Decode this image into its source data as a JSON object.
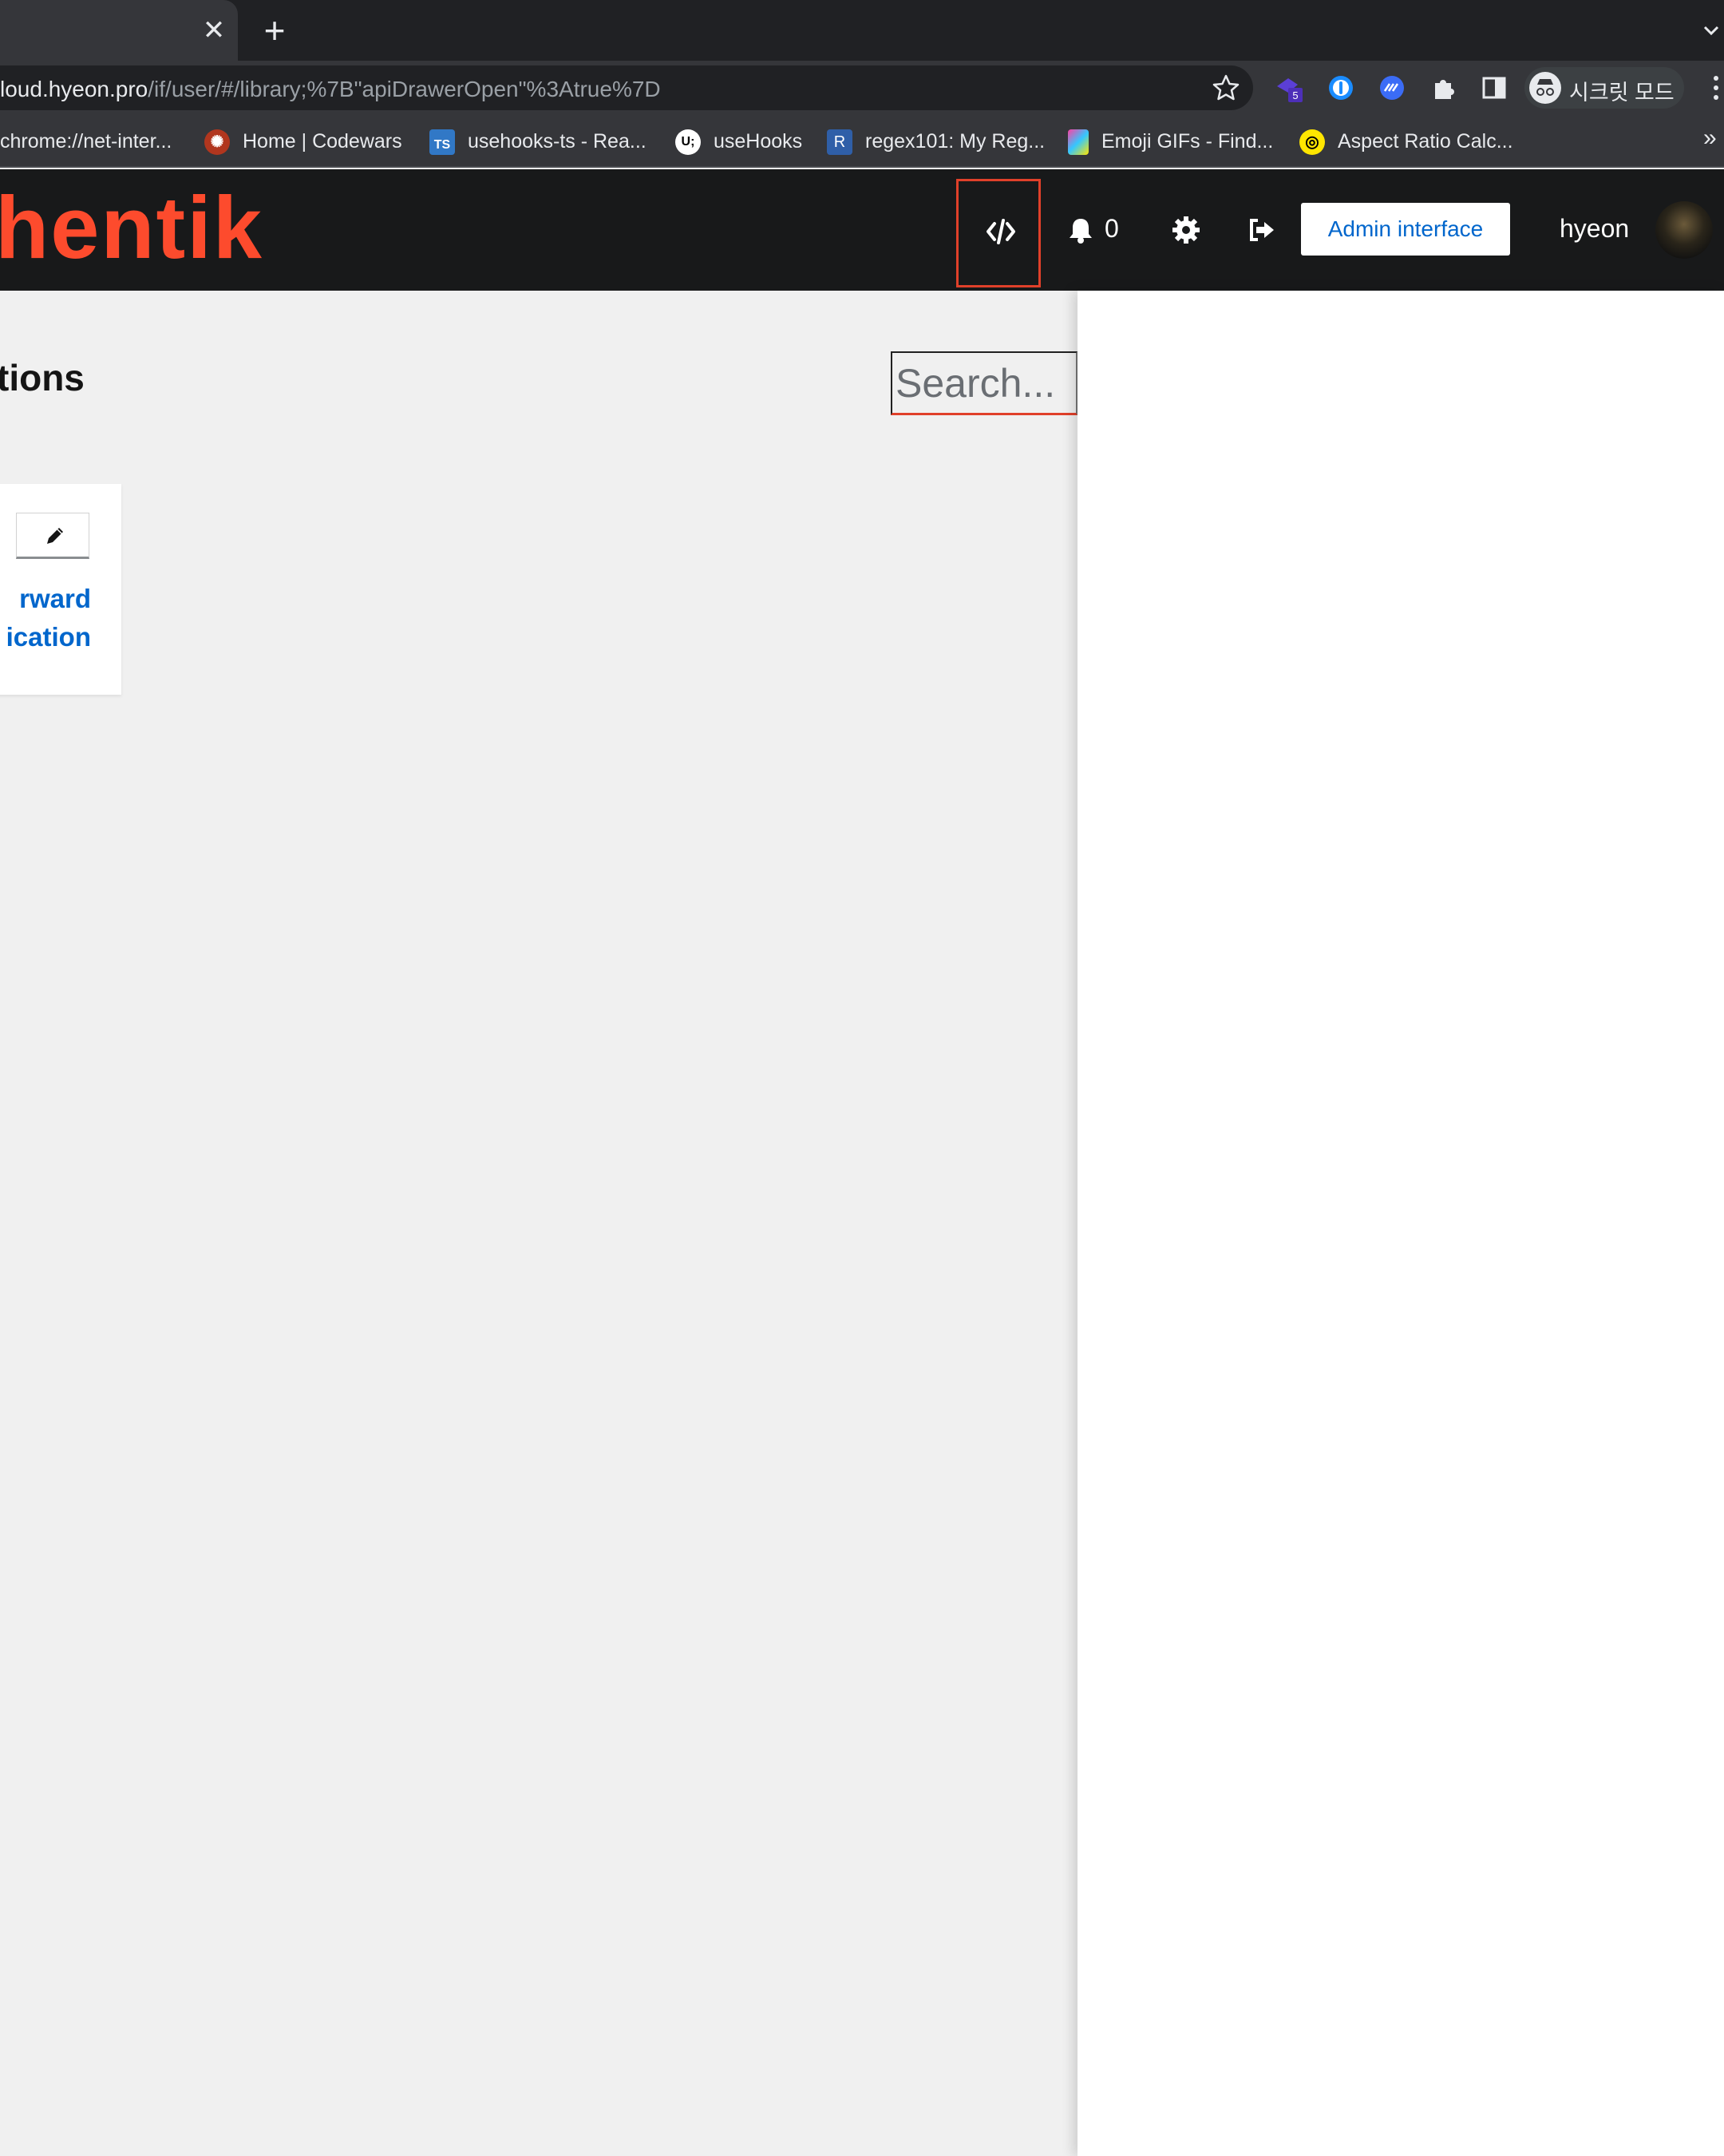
{
  "browser": {
    "tab_close": "✕",
    "new_tab": "+",
    "url_host": "loud.hyeon.pro",
    "url_path": "/if/user/#/library;%7B\"apiDrawerOpen\"%3Atrue%7D",
    "extension_badge": "5",
    "incognito_label": "시크릿 모드",
    "bookmarks": [
      {
        "label": "chrome://net-inter...",
        "icon": "chrome-icon"
      },
      {
        "label": "Home | Codewars",
        "icon": "codewars-icon"
      },
      {
        "label": "usehooks-ts - Rea...",
        "icon": "typescript-icon",
        "glyph": "TS"
      },
      {
        "label": "useHooks",
        "icon": "usehooks-icon",
        "glyph": "U;"
      },
      {
        "label": "regex101: My Reg...",
        "icon": "regex101-icon",
        "glyph": "R"
      },
      {
        "label": "Emoji GIFs - Find...",
        "icon": "emoji-gifs-icon"
      },
      {
        "label": "Aspect Ratio Calc...",
        "icon": "aspect-ratio-icon"
      }
    ],
    "more_bookmarks": "»"
  },
  "header": {
    "logo_text": "hentik",
    "notification_count": "0",
    "admin_button": "Admin interface",
    "username": "hyeon"
  },
  "main": {
    "title": "tions",
    "search_placeholder": "Search...",
    "card": {
      "name_line1": "rward",
      "name_line2": "ication"
    }
  },
  "colors": {
    "brand": "#fd4b2d",
    "link": "#0066cc",
    "highlight_border": "#e0402a"
  }
}
